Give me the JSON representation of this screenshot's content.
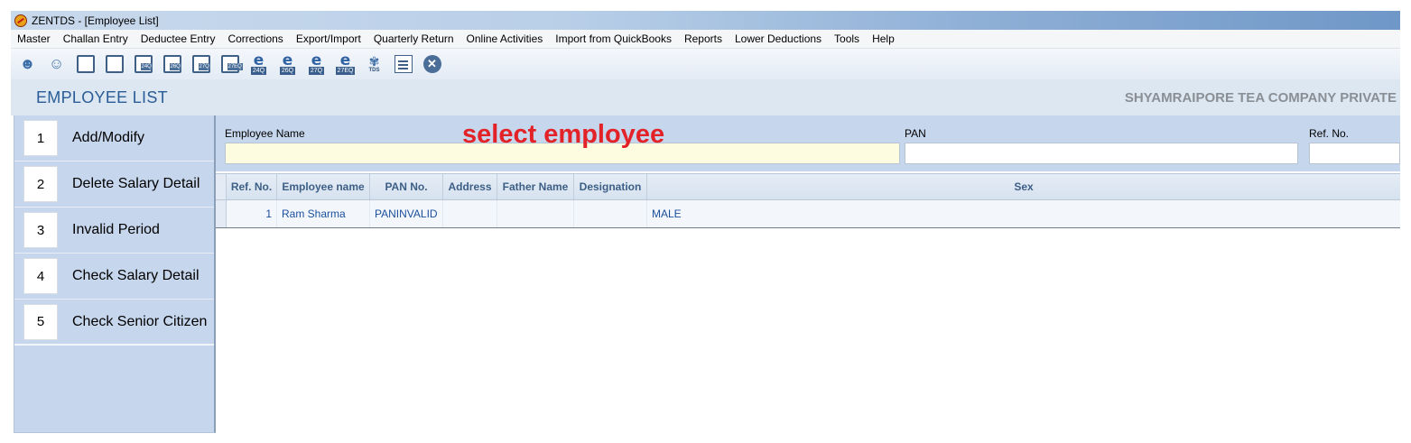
{
  "window": {
    "title": "ZENTDS - [Employee List]"
  },
  "menu": [
    "Master",
    "Challan Entry",
    "Deductee Entry",
    "Corrections",
    "Export/Import",
    "Quarterly Return",
    "Online Activities",
    "Import from QuickBooks",
    "Reports",
    "Lower Deductions",
    "Tools",
    "Help"
  ],
  "toolbar": {
    "form_tags": [
      "24Q",
      "26Q",
      "27Q",
      "27EQ"
    ],
    "efile_tags": [
      "24Q",
      "26Q",
      "27Q",
      "27EQ"
    ],
    "tds_label": "TDS",
    "icons": [
      "employee-icon",
      "employees-group-icon",
      "deductee-form-icon",
      "deductee-alt-form-icon",
      "form-24q-icon",
      "form-26q-icon",
      "form-27q-icon",
      "form-27eq-icon",
      "efile-24q-icon",
      "efile-26q-icon",
      "efile-27q-icon",
      "efile-27eq-icon",
      "tds-icon",
      "report-document-icon",
      "close-icon"
    ]
  },
  "header": {
    "page_title": "EMPLOYEE LIST",
    "company": "SHYAMRAIPORE TEA COMPANY PRIVATE"
  },
  "sidebar": {
    "items": [
      {
        "num": "1",
        "label": "Add/Modify"
      },
      {
        "num": "2",
        "label": "Delete Salary Detail"
      },
      {
        "num": "3",
        "label": "Invalid Period"
      },
      {
        "num": "4",
        "label": "Check Salary Detail"
      },
      {
        "num": "5",
        "label": "Check Senior Citizen"
      }
    ]
  },
  "search": {
    "employee_name_label": "Employee Name",
    "employee_name_value": "",
    "pan_label": "PAN",
    "pan_value": "",
    "ref_label": "Ref. No.",
    "ref_value": ""
  },
  "annotation": "select employee",
  "table": {
    "columns": [
      "Ref. No.",
      "Employee name",
      "PAN No.",
      "Address",
      "Father Name",
      "Designation",
      "Sex"
    ],
    "rows": [
      {
        "ref_no": "1",
        "employee_name": "Ram Sharma",
        "pan_no": "PANINVALID",
        "address": "",
        "father_name": "",
        "designation": "",
        "sex": "MALE"
      }
    ]
  },
  "colors": {
    "accent": "#2a5d97",
    "sidebar_bg": "#c6d6ec",
    "annotation": "#e32228",
    "highlight_input": "#fdfbe0"
  }
}
